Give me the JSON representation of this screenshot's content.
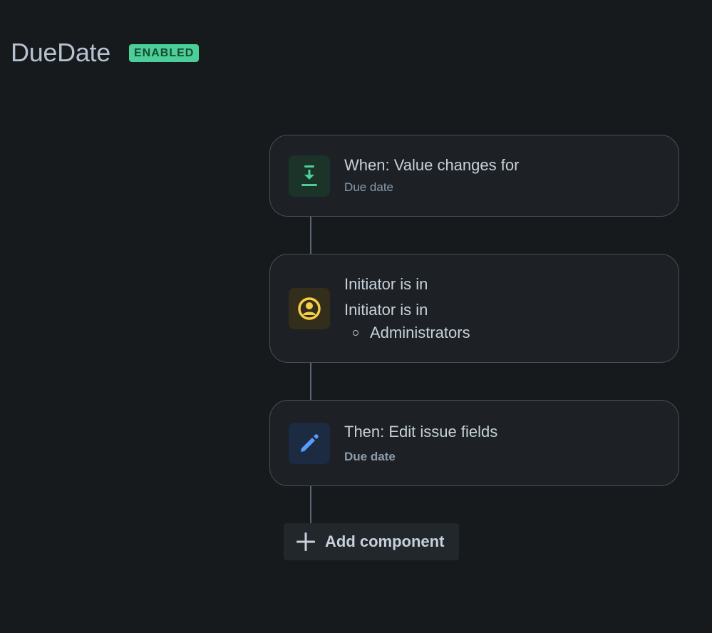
{
  "header": {
    "title": "DueDate",
    "status_badge": "ENABLED"
  },
  "components": [
    {
      "kind": "trigger",
      "icon": "download-arrow-icon",
      "icon_color": "#4bce97",
      "icon_bg": "#1c3329",
      "title": "When: Value changes for",
      "subtitle": "Due date"
    },
    {
      "kind": "condition",
      "icon": "user-circle-icon",
      "icon_color": "#f5cd47",
      "icon_bg": "#332e1b",
      "title": "Initiator is in",
      "detail": "Initiator is in",
      "items": [
        "Administrators"
      ]
    },
    {
      "kind": "action",
      "icon": "pencil-icon",
      "icon_color": "#579dff",
      "icon_bg": "#1c2b41",
      "title": "Then: Edit issue fields",
      "subtitle": "Due date"
    }
  ],
  "add_component": {
    "label": "Add component",
    "icon": "plus-icon"
  }
}
